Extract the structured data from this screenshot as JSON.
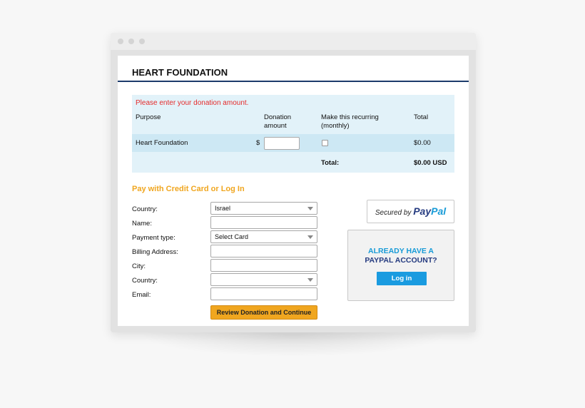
{
  "page": {
    "title": "HEART FOUNDATION"
  },
  "donation": {
    "error": "Please enter your donation amount.",
    "headers": {
      "purpose": "Purpose",
      "amount_line1": "Donation",
      "amount_line2": "amount",
      "recurring_line1": "Make this recurring",
      "recurring_line2": "(monthly)",
      "total": "Total"
    },
    "row": {
      "purpose": "Heart Foundation",
      "currency": "$",
      "amount": "",
      "recurring_checked": false,
      "total": "$0.00"
    },
    "footer": {
      "label": "Total:",
      "value": "$0.00 USD"
    }
  },
  "payment": {
    "heading": "Pay with Credit Card or Log In",
    "fields": {
      "country_label": "Country:",
      "country_value": "Israel",
      "name_label": "Name:",
      "name_value": "",
      "payment_type_label": "Payment type:",
      "payment_type_value": "Select Card",
      "billing_label": "Billing Address:",
      "billing_value": "",
      "city_label": "City:",
      "city_value": "",
      "country2_label": "Country:",
      "country2_value": "",
      "email_label": "Email:",
      "email_value": ""
    },
    "review_button": "Review Donation and Continue"
  },
  "paypal": {
    "secured_by": "Secured by",
    "logo_pay": "Pay",
    "logo_pal": "Pal",
    "already_line1": "ALREADY HAVE A",
    "already_line2": "PAYPAL ACCOUNT?",
    "login_button": "Log in"
  },
  "colors": {
    "accent_orange": "#f0a61f",
    "paypal_dark": "#253b80",
    "paypal_light": "#179bd7",
    "error_red": "#e52b2b",
    "header_rule": "#1c3b6b"
  }
}
